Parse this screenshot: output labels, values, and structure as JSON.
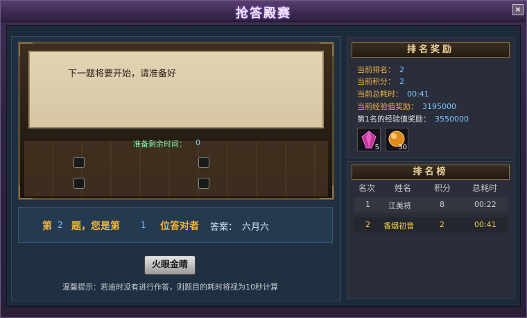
{
  "window": {
    "title": "抢答殿赛",
    "close_label": "×"
  },
  "question": {
    "text": "下一题将要开始，请准备好",
    "timer_label": "准备剩余时间：",
    "timer_value": "0"
  },
  "status": {
    "part1": "第",
    "question_no": "2",
    "part2": "题，您是第",
    "rank_no": "1",
    "part3": "位答对者",
    "answer_label": "答案：",
    "answer_value": "六月六"
  },
  "actions": {
    "button_label": "火眼金睛"
  },
  "tip": "温馨提示：若逾时没有进行作答，则题目的耗时将视为10秒计算",
  "rewards": {
    "title": "排名奖励",
    "rows": [
      {
        "label": "当前排名：",
        "value": "2"
      },
      {
        "label": "当前积分：",
        "value": "2"
      },
      {
        "label": "当前总耗时：",
        "value": "00:41"
      },
      {
        "label": "当前经验值奖励：",
        "value": "3195000"
      },
      {
        "label": "第1名的经验值奖励：",
        "value": "3550000"
      }
    ],
    "items": [
      {
        "icon": "gem-icon",
        "count": "5"
      },
      {
        "icon": "orb-icon",
        "count": "30"
      }
    ]
  },
  "leaderboard": {
    "title": "排名榜",
    "columns": [
      "名次",
      "姓名",
      "积分",
      "总耗时"
    ],
    "rows": [
      {
        "rank": "1",
        "name": "江美将",
        "score": "8",
        "time": "00:22"
      },
      {
        "rank": "2",
        "name": "香烟初音",
        "score": "2",
        "time": "00:41"
      }
    ]
  },
  "colors": {
    "accent_gold": "#f2b53a",
    "value_blue": "#7fc4ff",
    "timer_green": "#7cf0a6"
  }
}
